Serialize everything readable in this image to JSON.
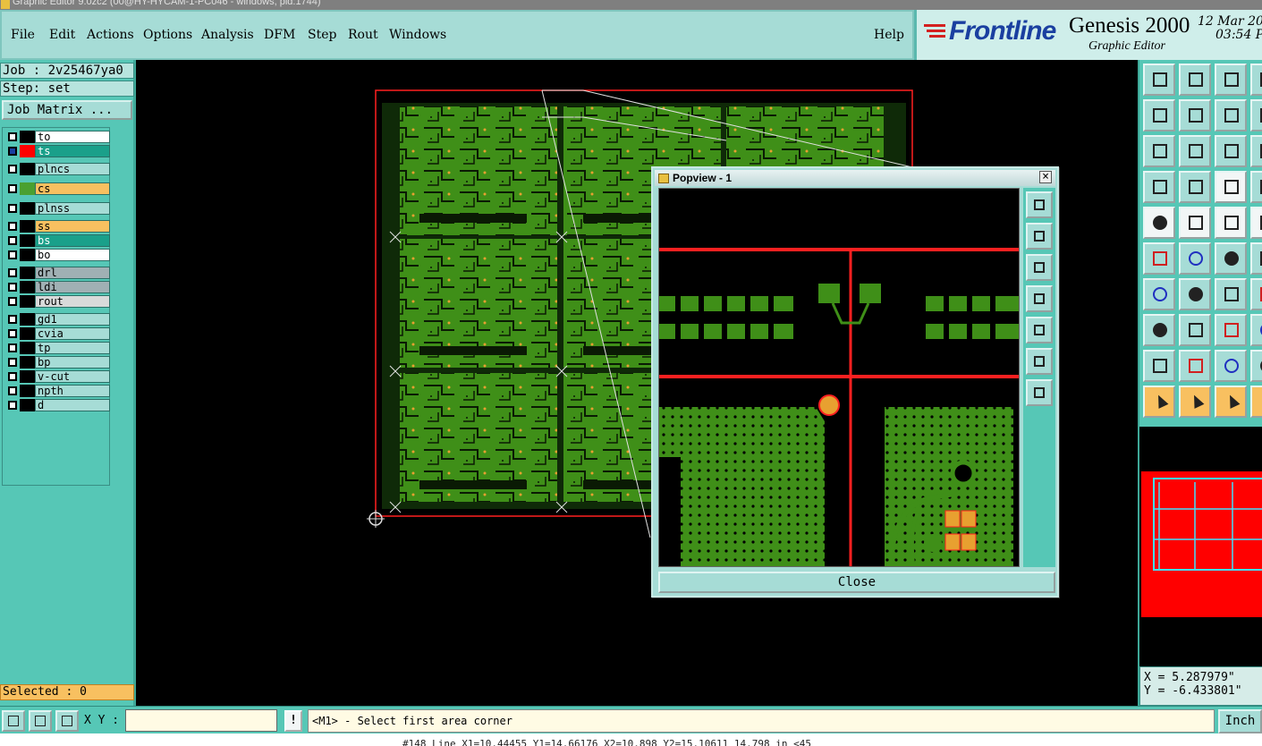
{
  "window": {
    "title": "Graphic Editor 9.0zc2 (00@HY-HYCAM-1-PC046 - windows, pid:1744)"
  },
  "menu": [
    "File",
    "Edit",
    "Actions",
    "Options",
    "Analysis",
    "DFM",
    "Step",
    "Rout",
    "Windows"
  ],
  "help": "Help",
  "brand": {
    "logo": "Frontline",
    "product": "Genesis 2000",
    "subtitle": "Graphic Editor",
    "date": "12 Mar 20",
    "time": "03:54 P"
  },
  "job": {
    "job_line": "Job : 2v25467ya0",
    "step_line": "Step: set",
    "matrix_button": "Job Matrix ..."
  },
  "layers": [
    {
      "name": "to",
      "color": "#ffffff",
      "swatch": "#000000"
    },
    {
      "name": "ts",
      "color": "#1aa08a",
      "swatch": "#ff0000",
      "active": true
    },
    {
      "name": "plncs",
      "color": "#a6dcd6",
      "swatch": "#000000"
    },
    {
      "name": "cs",
      "color": "#f8c060",
      "swatch": "#4aa030"
    },
    {
      "name": "plnss",
      "color": "#a6dcd6",
      "swatch": "#000000"
    },
    {
      "name": "ss",
      "color": "#f8c060",
      "swatch": "#000000"
    },
    {
      "name": "bs",
      "color": "#1aa08a",
      "swatch": "#000000"
    },
    {
      "name": "bo",
      "color": "#ffffff",
      "swatch": "#000000"
    },
    {
      "name": "drl",
      "color": "#a0b0b4",
      "swatch": "#000000"
    },
    {
      "name": "ldi",
      "color": "#a0b0b4",
      "swatch": "#000000"
    },
    {
      "name": "rout",
      "color": "#d8dada",
      "swatch": "#000000"
    },
    {
      "name": "gd1",
      "color": "#a6dcd6",
      "swatch": "#000000"
    },
    {
      "name": "cvia",
      "color": "#a6dcd6",
      "swatch": "#000000"
    },
    {
      "name": "tp",
      "color": "#a6dcd6",
      "swatch": "#000000"
    },
    {
      "name": "bp",
      "color": "#a6dcd6",
      "swatch": "#000000"
    },
    {
      "name": "v-cut",
      "color": "#a6dcd6",
      "swatch": "#000000"
    },
    {
      "name": "npth",
      "color": "#a6dcd6",
      "swatch": "#000000"
    },
    {
      "name": "d",
      "color": "#a6dcd6",
      "swatch": "#000000"
    }
  ],
  "selected": "Selected : 0",
  "popview": {
    "title": "Popview - 1",
    "close_label": "Close",
    "close_x": "×"
  },
  "coords": {
    "x": "X =  5.287979\"",
    "y": "Y = -6.433801\""
  },
  "status": {
    "xy_label": "X Y :",
    "xy_value": "",
    "warn": "!",
    "message": "<M1> - Select first area corner",
    "unit": "Inch",
    "bottom": "#148 Line  X1=10.44455  Y1=14.66176  X2=10.898  Y2=15.10611  14.798 in  <45"
  },
  "colors": {
    "teal": "#56c7b6",
    "panel": "#a6dcd6",
    "pcb_green": "#3f8f18",
    "red": "#ff0000"
  }
}
